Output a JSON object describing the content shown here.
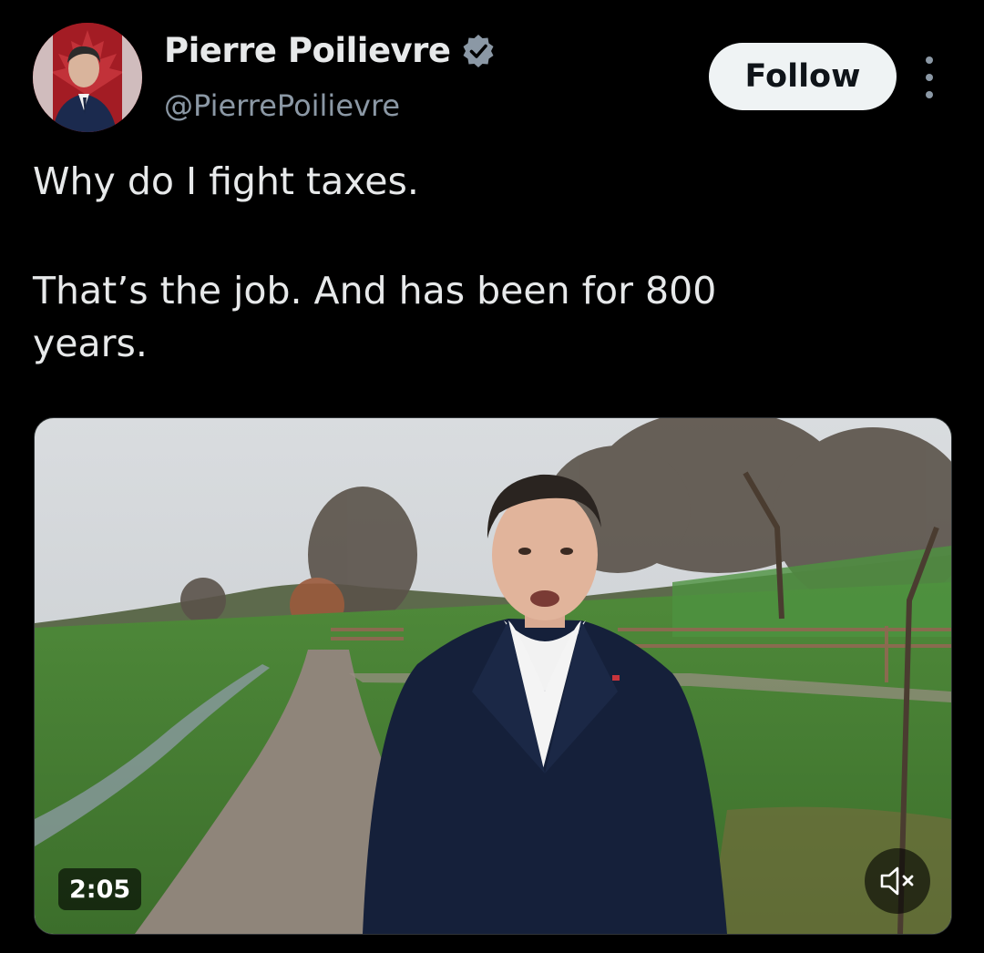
{
  "author": {
    "display_name": "Pierre Poilievre",
    "handle": "@PierrePoilievre",
    "verified": true,
    "avatar_icon": "profile-photo"
  },
  "actions": {
    "follow_label": "Follow",
    "more_icon": "more-options-icon"
  },
  "tweet": {
    "line1": "Why do I fight taxes.",
    "line2": "That’s the job. And has been for 800",
    "line3": "years."
  },
  "video": {
    "duration": "2:05",
    "mute_icon": "volume-muted-icon"
  },
  "colors": {
    "background": "#000000",
    "text": "#e7e9ea",
    "secondary_text": "#8b98a5",
    "verified_badge": "#1d9bf0",
    "follow_button_bg": "#eff3f4"
  }
}
